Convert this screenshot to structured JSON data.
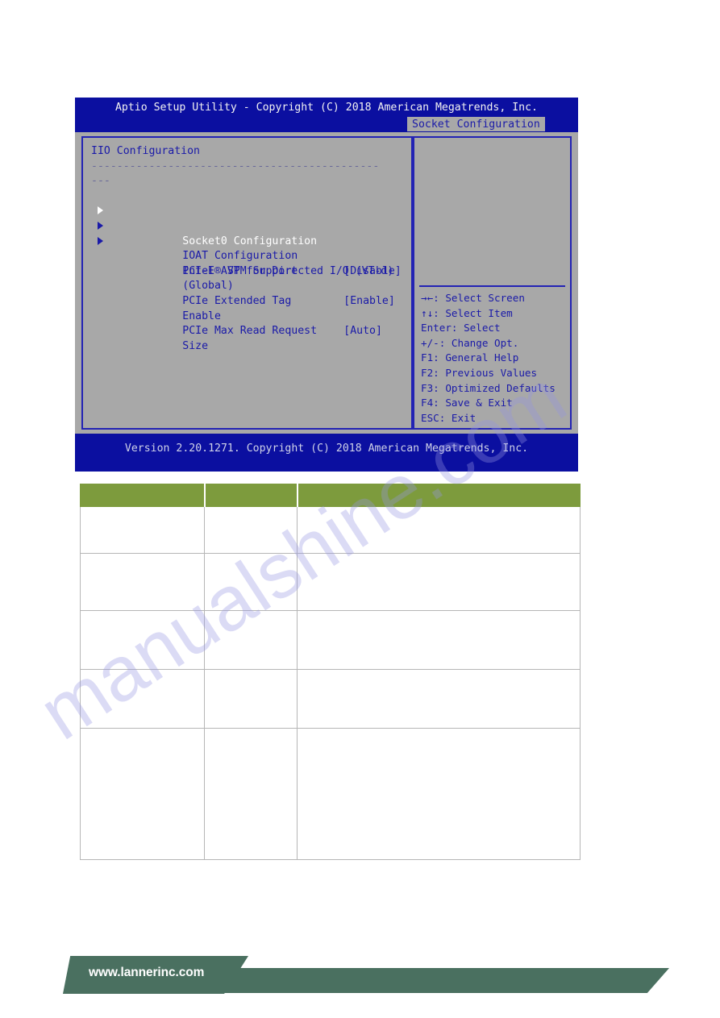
{
  "bios": {
    "title": "Aptio Setup Utility - Copyright (C) 2018 American Megatrends, Inc.",
    "active_tab": "Socket Configuration",
    "version_bar": "Version 2.20.1271. Copyright (C) 2018 American Megatrends, Inc.",
    "left_pane": {
      "heading": "IIO Configuration",
      "separator_line": "---------------------------------------------",
      "separator_wrap": "---",
      "submenus": [
        {
          "label": "Socket0 Configuration",
          "selected": true
        },
        {
          "label": "IOAT Configuration",
          "selected": false
        },
        {
          "label": "Intel® VT for Directed I/O (VT-d)",
          "selected": false
        }
      ],
      "options": [
        {
          "label": "PCI-E ASPM Support",
          "label_wrap": "(Global)",
          "value": "[Disable]"
        },
        {
          "label": "PCIe Extended Tag",
          "label_wrap": "Enable",
          "value": "[Enable]"
        },
        {
          "label": "PCIe Max Read Request",
          "label_wrap": "Size",
          "value": "[Auto]"
        }
      ]
    },
    "help_pane": {
      "keys": [
        {
          "key": "→←:",
          "action": " Select Screen"
        },
        {
          "key": "↑↓:",
          "action": " Select Item"
        },
        {
          "key": "Enter:",
          "action": " Select"
        },
        {
          "key": "+/-:",
          "action": " Change Opt."
        },
        {
          "key": "F1:",
          "action": " General Help"
        },
        {
          "key": "F2:",
          "action": " Previous Values"
        },
        {
          "key": "F3:",
          "action": " Optimized Defaults"
        },
        {
          "key": "F4:",
          "action": " Save & Exit"
        },
        {
          "key": "ESC:",
          "action": " Exit"
        }
      ]
    }
  },
  "table": {
    "header_color": "#7d9b3d",
    "columns": [
      {
        "label": ""
      },
      {
        "label": ""
      },
      {
        "label": ""
      }
    ],
    "rows": [
      [
        "",
        "",
        ""
      ],
      [
        "",
        "",
        ""
      ],
      [
        "",
        "",
        ""
      ],
      [
        "",
        "",
        ""
      ],
      [
        "",
        "",
        ""
      ]
    ]
  },
  "watermark": {
    "text": "manualshine.com"
  },
  "footer": {
    "url": "www.lannerinc.com",
    "color": "#4a7060"
  }
}
